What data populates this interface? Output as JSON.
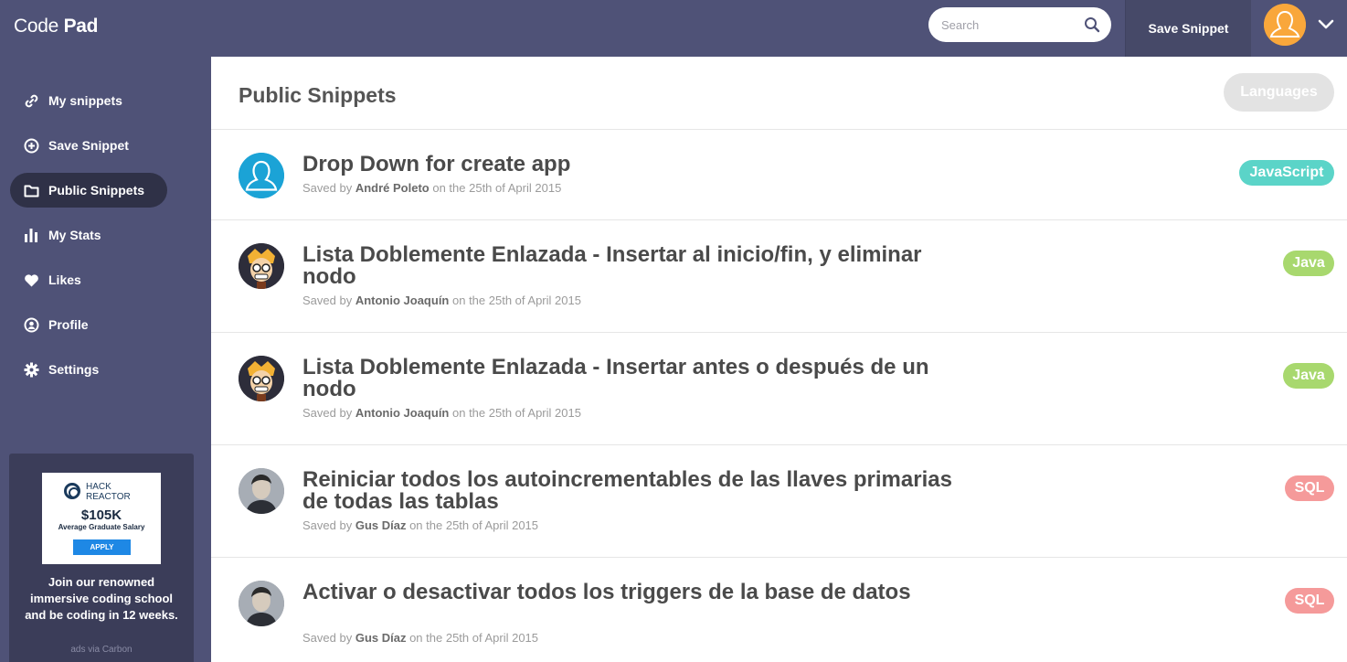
{
  "app": {
    "logo_light": "Code",
    "logo_bold": "Pad"
  },
  "header": {
    "search_placeholder": "Search",
    "save_label": "Save Snippet",
    "search_icon": "search-icon",
    "user_menu_icon": "chevron-down-icon"
  },
  "sidebar": {
    "items": [
      {
        "label": "My snippets",
        "icon": "link-icon",
        "active": false
      },
      {
        "label": "Save Snippet",
        "icon": "plus-circle-icon",
        "active": false
      },
      {
        "label": "Public Snippets",
        "icon": "folder-icon",
        "active": true
      },
      {
        "label": "My Stats",
        "icon": "bar-chart-icon",
        "active": false
      },
      {
        "label": "Likes",
        "icon": "heart-icon",
        "active": false
      },
      {
        "label": "Profile",
        "icon": "profile-icon",
        "active": false
      },
      {
        "label": "Settings",
        "icon": "gear-icon",
        "active": false
      }
    ],
    "ad": {
      "brand_line1": "HACK",
      "brand_line2": "REACTOR",
      "salary": "$105K",
      "salary_sub": "Average Graduate Salary",
      "apply": "APPLY",
      "text": "Join our renowned immersive coding school and be coding in 12 weeks.",
      "via": "ads via Carbon"
    }
  },
  "main": {
    "title": "Public Snippets",
    "languages_button": "Languages",
    "snippets": [
      {
        "title": "Drop Down for create app",
        "saved_by_prefix": "Saved by",
        "author": "André Poleto",
        "date": "on the 25th of April 2015",
        "language": "JavaScript",
        "language_color": "#5bd4c8",
        "avatar": "default"
      },
      {
        "title": "Lista Doblemente Enlazada - Insertar al inicio/fin, y eliminar nodo",
        "saved_by_prefix": "Saved by",
        "author": "Antonio Joaquín",
        "date": "on the 25th of April 2015",
        "language": "Java",
        "language_color": "#a8d86e",
        "avatar": "cartoon"
      },
      {
        "title": "Lista Doblemente Enlazada - Insertar antes o después de un nodo",
        "saved_by_prefix": "Saved by",
        "author": "Antonio Joaquín",
        "date": "on the 25th of April 2015",
        "language": "Java",
        "language_color": "#a8d86e",
        "avatar": "cartoon"
      },
      {
        "title": "Reiniciar todos los autoincrementables de las llaves primarias de todas las tablas",
        "saved_by_prefix": "Saved by",
        "author": "Gus Díaz",
        "date": "on the 25th of April 2015",
        "language": "SQL",
        "language_color": "#f59a9a",
        "avatar": "photo"
      },
      {
        "title": "Activar o desactivar todos los triggers de la base de datos",
        "saved_by_prefix": "Saved by",
        "author": "Gus Díaz",
        "date": "on the 25th of April 2015",
        "language": "SQL",
        "language_color": "#f59a9a",
        "avatar": "photo"
      }
    ]
  },
  "colors": {
    "sidebar_bg": "#4f5277",
    "active_nav_bg": "#2f3147",
    "title_text": "#4a4a4a"
  }
}
